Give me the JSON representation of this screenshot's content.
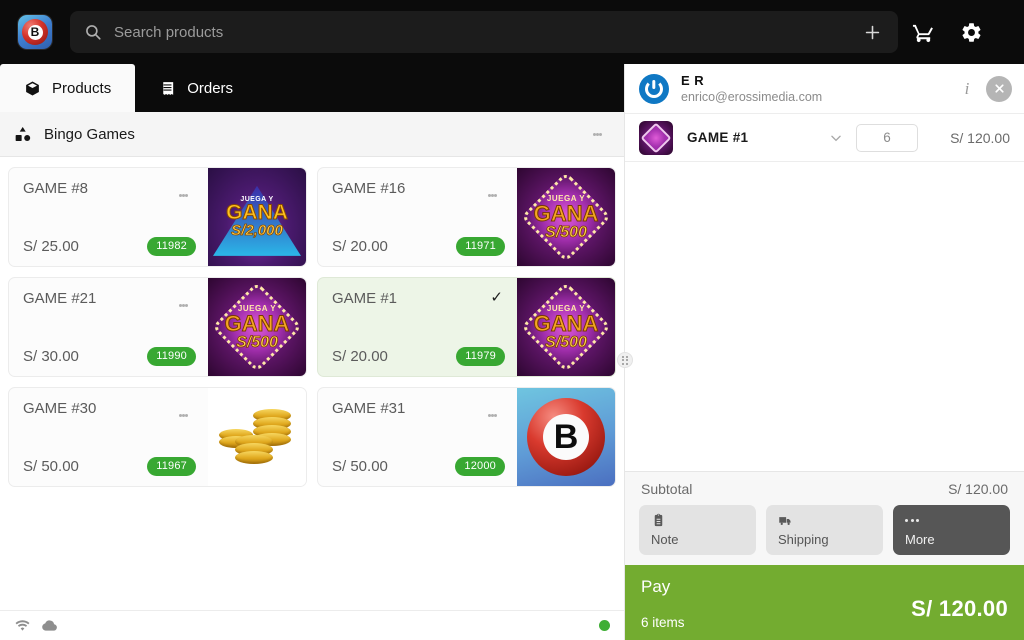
{
  "app": {
    "logo_letter": "B",
    "logo_icon": "bingo-ball-logo"
  },
  "search": {
    "placeholder": "Search products",
    "value": "",
    "icon": "search-icon",
    "add_icon": "plus-icon"
  },
  "topbar": {
    "cart_icon": "shopping-cart-icon",
    "settings_icon": "gear-icon"
  },
  "tabs": [
    {
      "label": "Products",
      "icon": "cube-icon",
      "active": true
    },
    {
      "label": "Orders",
      "icon": "receipt-icon",
      "active": false
    }
  ],
  "collection": {
    "title": "Bingo Games",
    "icon": "shapes-icon",
    "menu_icon": "kebab-menu-icon"
  },
  "products": [
    {
      "name": "GAME #8",
      "price": "S/ 25.00",
      "badge": "11982",
      "selected": false,
      "art": "gana-2000"
    },
    {
      "name": "GAME #16",
      "price": "S/ 20.00",
      "badge": "11971",
      "selected": false,
      "art": "gana-500"
    },
    {
      "name": "GAME #21",
      "price": "S/ 30.00",
      "badge": "11990",
      "selected": false,
      "art": "gana-500"
    },
    {
      "name": "GAME #1",
      "price": "S/ 20.00",
      "badge": "11979",
      "selected": true,
      "art": "gana-500"
    },
    {
      "name": "GAME #30",
      "price": "S/ 50.00",
      "badge": "11967",
      "selected": false,
      "art": "coins"
    },
    {
      "name": "GAME #31",
      "price": "S/ 50.00",
      "badge": "12000",
      "selected": false,
      "art": "bingo-ball"
    }
  ],
  "artwork": {
    "gana_2000": {
      "line1": "JUEGA Y",
      "line2": "GANA",
      "line3": "S/2,000"
    },
    "gana_500": {
      "line1": "JUEGA Y",
      "line2": "GANA",
      "line3": "S/500"
    },
    "bingo_letter": "B"
  },
  "customer": {
    "name": "E R",
    "email": "enrico@erossimedia.com",
    "avatar_icon": "customer-avatar",
    "info_icon": "info-icon",
    "close_icon": "close-circle-icon"
  },
  "cart": {
    "items": [
      {
        "name": "GAME #1",
        "quantity": "6",
        "price": "S/ 120.00",
        "thumb": "gana-500-tile"
      }
    ],
    "chevron_icon": "chevron-down-icon",
    "subtotal_label": "Subtotal",
    "subtotal_value": "S/ 120.00"
  },
  "cart_actions": [
    {
      "label": "Note",
      "icon": "clipboard-icon",
      "style": "light"
    },
    {
      "label": "Shipping",
      "icon": "truck-icon",
      "style": "light"
    },
    {
      "label": "More",
      "icon": "ellipsis-icon",
      "style": "dark"
    }
  ],
  "pay": {
    "label": "Pay",
    "items_text": "6 items",
    "total": "S/ 120.00",
    "color": "#73ac30"
  },
  "statusbar": {
    "wifi_icon": "wifi-icon",
    "cloud_icon": "cloud-icon",
    "status_dot": "online-status-dot",
    "status_color": "#3fae35"
  },
  "resizer": {
    "icon": "panel-resize-handle"
  }
}
